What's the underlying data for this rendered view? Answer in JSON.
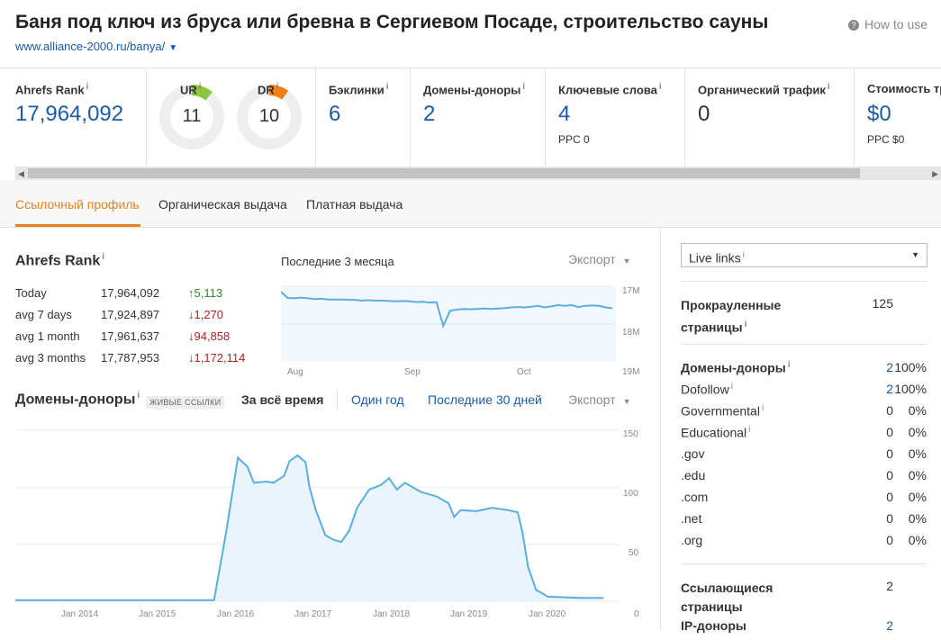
{
  "header": {
    "title": "Баня под ключ из бруса или бревна в Сергиевом Посаде, строительство сауны",
    "url": "www.alliance-2000.ru/banya/",
    "how_to_use": "How to use"
  },
  "metrics": {
    "ahrefs_rank": {
      "label": "Ahrefs Rank",
      "value": "17,964,092"
    },
    "ur": {
      "label": "UR",
      "value": "11",
      "fill": 0.11,
      "color": "#8dc63f"
    },
    "dr": {
      "label": "DR",
      "value": "10",
      "fill": 0.1,
      "color": "#f07f15"
    },
    "backlinks": {
      "label": "Бэклинки",
      "value": "6"
    },
    "ref_domains": {
      "label": "Домены-доноры",
      "value": "2"
    },
    "keywords": {
      "label": "Ключевые слова",
      "value": "4",
      "sub": "PPC 0"
    },
    "organic_traffic": {
      "label": "Органический трафик",
      "value": "0"
    },
    "traffic_value": {
      "label": "Стоимость тр",
      "value": "$0",
      "sub": "PPC $0"
    }
  },
  "tabs": [
    {
      "label": "Ссылочный профиль",
      "active": true
    },
    {
      "label": "Органическая выдача",
      "active": false
    },
    {
      "label": "Платная выдача",
      "active": false
    }
  ],
  "rank_section": {
    "title": "Ahrefs Rank",
    "rows": [
      {
        "period": "Today",
        "value": "17,964,092",
        "delta": "5,113",
        "dir": "up"
      },
      {
        "period": "avg 7 days",
        "value": "17,924,897",
        "delta": "1,270",
        "dir": "down"
      },
      {
        "period": "avg 1 month",
        "value": "17,961,637",
        "delta": "94,858",
        "dir": "down"
      },
      {
        "period": "avg 3 months",
        "value": "17,787,953",
        "delta": "1,172,114",
        "dir": "down"
      }
    ],
    "chart_title": "Последние 3 месяца",
    "export": "Экспорт"
  },
  "ref_domains_section": {
    "title": "Домены-доноры",
    "badge": "ЖИВЫЕ ССЫЛКИ",
    "filters": [
      "За всё время",
      "Один год",
      "Последние 30 дней"
    ],
    "export": "Экспорт"
  },
  "chart_data": [
    {
      "type": "line",
      "title": "Последние 3 месяца",
      "x_ticks": [
        "Aug",
        "Sep",
        "Oct"
      ],
      "y_ticks": [
        "17M",
        "18M",
        "19M"
      ],
      "ylim": [
        17000000,
        19000000
      ],
      "y_reversed": true,
      "series": [
        {
          "values": [
            17150000,
            17310000,
            17320000,
            17300000,
            17320000,
            17340000,
            17330000,
            17350000,
            17350000,
            17350000,
            17360000,
            17360000,
            17380000,
            17370000,
            17380000,
            17380000,
            17390000,
            17400000,
            17390000,
            17400000,
            17420000,
            17410000,
            17430000,
            17420000,
            18050000,
            17650000,
            17620000,
            17600000,
            17610000,
            17600000,
            17590000,
            17600000,
            17590000,
            17580000,
            17560000,
            17550000,
            17560000,
            17540000,
            17520000,
            17560000,
            17530000,
            17500000,
            17520000,
            17500000,
            17550000,
            17520000,
            17510000,
            17520000,
            17560000,
            17580000
          ]
        }
      ]
    },
    {
      "type": "area",
      "title": "Домены-доноры",
      "x_ticks": [
        "Jan 2014",
        "Jan 2015",
        "Jan 2016",
        "Jan 2017",
        "Jan 2018",
        "Jan 2019",
        "Jan 2020"
      ],
      "y_ticks": [
        "150",
        "100",
        "50",
        "0"
      ],
      "ylim": [
        0,
        150
      ],
      "x_start_year": 2013.4,
      "series": [
        {
          "points": [
            [
              2013.4,
              1
            ],
            [
              2015.9,
              1
            ],
            [
              2016.05,
              60
            ],
            [
              2016.2,
              126
            ],
            [
              2016.32,
              118
            ],
            [
              2016.4,
              104
            ],
            [
              2016.55,
              105
            ],
            [
              2016.65,
              104
            ],
            [
              2016.78,
              110
            ],
            [
              2016.85,
              123
            ],
            [
              2016.95,
              128
            ],
            [
              2017.05,
              122
            ],
            [
              2017.1,
              100
            ],
            [
              2017.18,
              80
            ],
            [
              2017.3,
              58
            ],
            [
              2017.4,
              54
            ],
            [
              2017.5,
              52
            ],
            [
              2017.6,
              62
            ],
            [
              2017.7,
              82
            ],
            [
              2017.85,
              98
            ],
            [
              2018.0,
              102
            ],
            [
              2018.1,
              108
            ],
            [
              2018.2,
              98
            ],
            [
              2018.3,
              104
            ],
            [
              2018.5,
              96
            ],
            [
              2018.7,
              92
            ],
            [
              2018.85,
              86
            ],
            [
              2018.92,
              74
            ],
            [
              2019.0,
              80
            ],
            [
              2019.2,
              79
            ],
            [
              2019.4,
              82
            ],
            [
              2019.6,
              80
            ],
            [
              2019.72,
              78
            ],
            [
              2019.78,
              60
            ],
            [
              2019.85,
              30
            ],
            [
              2019.95,
              10
            ],
            [
              2020.1,
              4
            ],
            [
              2020.5,
              3
            ],
            [
              2020.8,
              3
            ]
          ]
        }
      ]
    }
  ],
  "right_panel": {
    "select": "Live links",
    "crawled": {
      "label": "Прокрауленные страницы",
      "value": "125"
    },
    "rows": [
      {
        "name": "Домены-доноры",
        "bold": true,
        "info": true,
        "num": "2",
        "pct": "100%",
        "link": true
      },
      {
        "name": "Dofollow",
        "bold": false,
        "info": true,
        "num": "2",
        "pct": "100%",
        "link": true
      },
      {
        "name": "Governmental",
        "bold": false,
        "info": true,
        "num": "0",
        "pct": "0%",
        "link": false
      },
      {
        "name": "Educational",
        "bold": false,
        "info": true,
        "num": "0",
        "pct": "0%",
        "link": false
      },
      {
        "name": ".gov",
        "bold": false,
        "info": false,
        "num": "0",
        "pct": "0%",
        "link": false
      },
      {
        "name": ".edu",
        "bold": false,
        "info": false,
        "num": "0",
        "pct": "0%",
        "link": false
      },
      {
        "name": ".com",
        "bold": false,
        "info": false,
        "num": "0",
        "pct": "0%",
        "link": false
      },
      {
        "name": ".net",
        "bold": false,
        "info": false,
        "num": "0",
        "pct": "0%",
        "link": false
      },
      {
        "name": ".org",
        "bold": false,
        "info": false,
        "num": "0",
        "pct": "0%",
        "link": false
      }
    ],
    "referring_pages": {
      "label": "Ссылающиеся страницы",
      "value": "2"
    },
    "ip_donors": {
      "label": "IP-доноры",
      "value": "2"
    }
  },
  "colors": {
    "accent": "#e8821e",
    "link": "#1a5aa8",
    "chart_line": "#5aafe0",
    "chart_fill": "#eaf4fb"
  },
  "info_mark": "i"
}
